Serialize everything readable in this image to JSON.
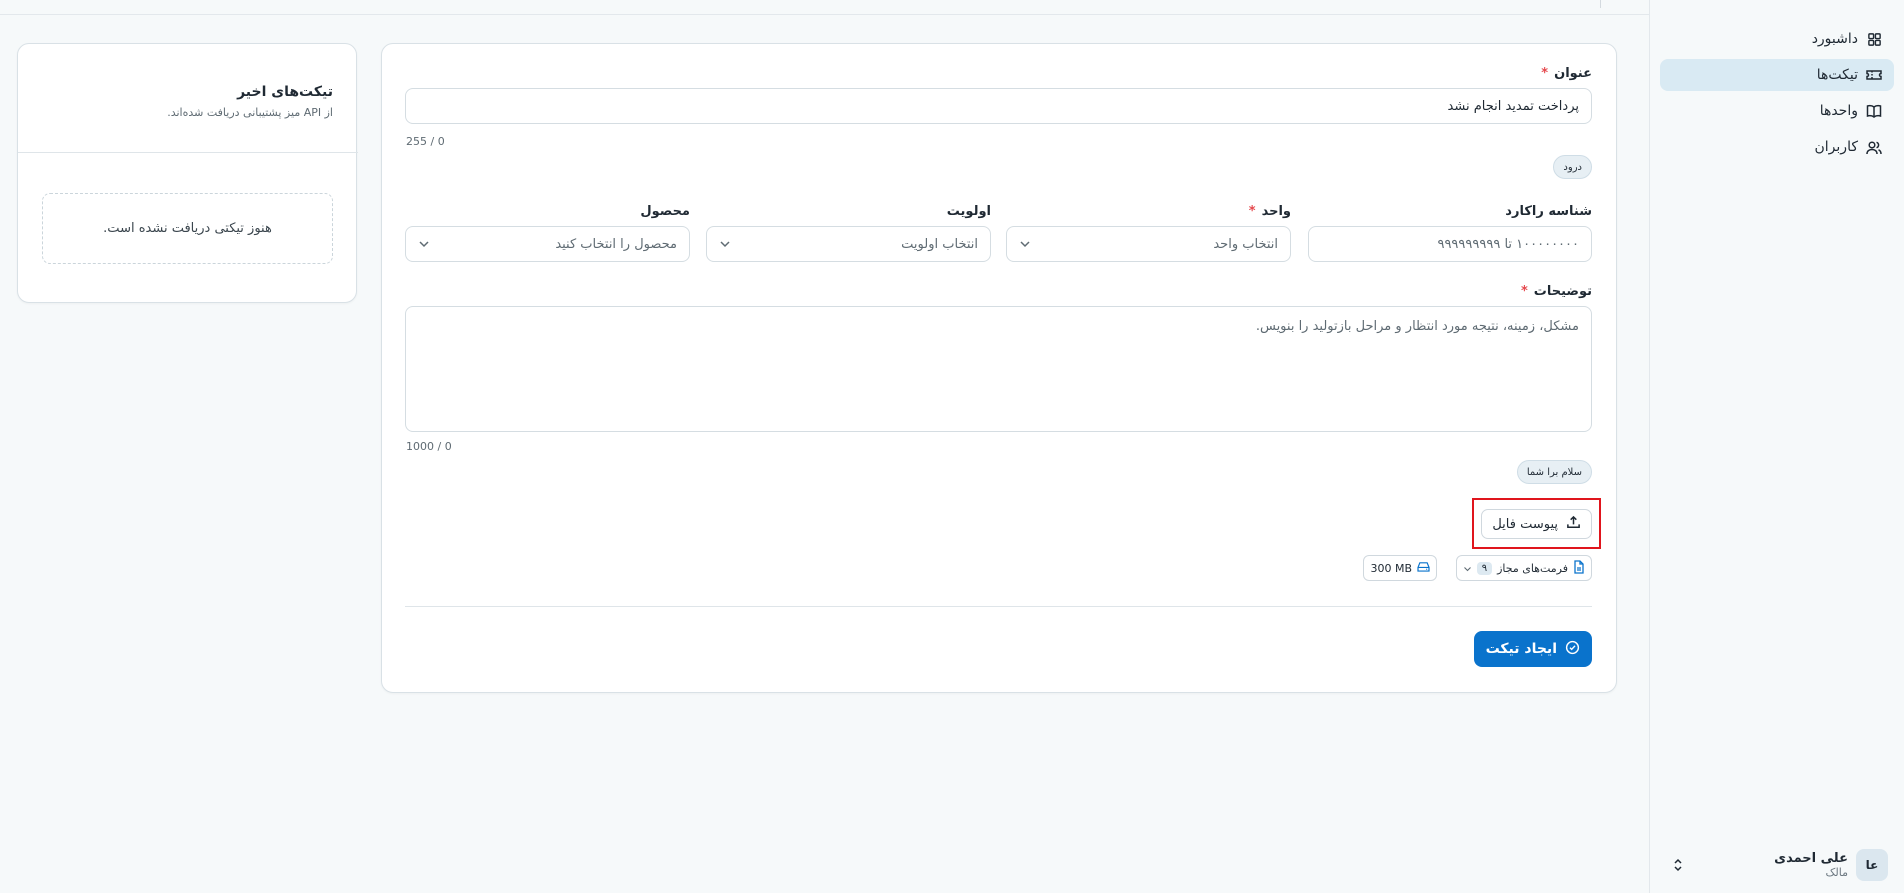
{
  "sidebar": {
    "items": [
      {
        "label": "داشبورد",
        "icon": "dashboard-grid-icon",
        "active": false
      },
      {
        "label": "تیکت‌ها",
        "icon": "ticket-icon",
        "active": true
      },
      {
        "label": "واحدها",
        "icon": "book-icon",
        "active": false
      },
      {
        "label": "کاربران",
        "icon": "users-icon",
        "active": false
      }
    ],
    "user": {
      "initials": "عا",
      "name": "علی احمدی",
      "role": "مالک"
    }
  },
  "form": {
    "title_label": "عنوان",
    "title_value": "پرداخت تمدید انجام نشد",
    "title_counter": "255 / 0",
    "greeting_chip": "درود",
    "tracking_label": "شناسه راکارد",
    "tracking_placeholder": "۱۰۰۰۰۰۰۰۰ تا ۹۹۹۹۹۹۹۹۹",
    "unit_label": "واحد",
    "unit_value": "انتخاب واحد",
    "priority_label": "اولویت",
    "priority_value": "انتخاب اولویت",
    "product_label": "محصول",
    "product_value": "محصول را انتخاب کنید",
    "description_label": "توضیحات",
    "description_placeholder": "مشکل، زمینه، نتیجه مورد انتظار و مراحل بازتولید را بنویس.",
    "description_counter": "1000 / 0",
    "hello_chip": "سلام برا شما",
    "attach_label": "پیوست فایل",
    "formats_label": "فرمت‌های مجاز",
    "formats_count": "۹",
    "max_size": "300 MB",
    "submit_label": "ایجاد تیکت"
  },
  "recent": {
    "title": "تیکت‌های اخیر",
    "subtitle": "از API میز پشتیبانی دریافت شده‌اند.",
    "empty_text": "هنوز تیکتی دریافت نشده است."
  },
  "colors": {
    "primary": "#0a73cc",
    "active_nav": "#d9eaf3",
    "highlight": "#e0151d",
    "required": "#e5484d"
  }
}
